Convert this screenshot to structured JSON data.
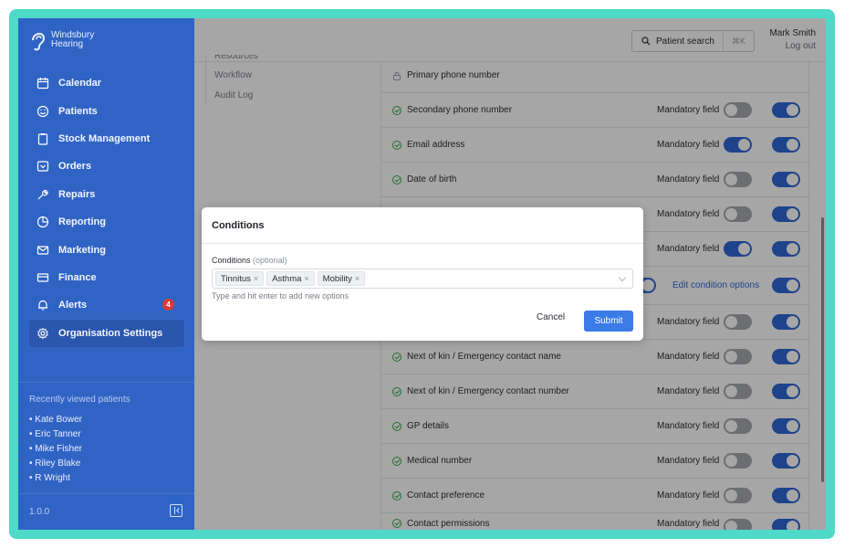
{
  "brand": {
    "line1": "Windsbury",
    "line2": "Hearing"
  },
  "sidebar": {
    "items": [
      {
        "label": "Calendar",
        "icon": "calendar-icon"
      },
      {
        "label": "Patients",
        "icon": "smiley-icon"
      },
      {
        "label": "Stock Management",
        "icon": "clipboard-icon"
      },
      {
        "label": "Orders",
        "icon": "inbox-icon"
      },
      {
        "label": "Repairs",
        "icon": "wrench-icon"
      },
      {
        "label": "Reporting",
        "icon": "pie-chart-icon"
      },
      {
        "label": "Marketing",
        "icon": "mail-icon"
      },
      {
        "label": "Finance",
        "icon": "credit-card-icon"
      },
      {
        "label": "Alerts",
        "icon": "bell-icon",
        "badge": "4"
      },
      {
        "label": "Organisation Settings",
        "icon": "gear-icon",
        "active": true
      }
    ],
    "recent_title": "Recently viewed patients",
    "recent": [
      "• Kate Bower",
      "• Eric Tanner",
      "• Mike Fisher",
      "• Riley Blake",
      "• R Wright"
    ],
    "version": "1.0.0"
  },
  "header": {
    "search_label": "Patient search",
    "search_shortcut": "⌘K",
    "user_name": "Mark Smith",
    "logout": "Log out"
  },
  "subnav": [
    "Resources",
    "Workflow",
    "Audit Log"
  ],
  "fields": {
    "mandatory_label": "Mandatory field",
    "edit_conditions": "Edit condition options",
    "rows": [
      {
        "label": "Primary phone number",
        "locked": true
      },
      {
        "label": "Secondary phone number",
        "mandatory": false,
        "enabled": true
      },
      {
        "label": "Email address",
        "mandatory": true,
        "enabled": true
      },
      {
        "label": "Date of birth",
        "mandatory": false,
        "enabled": true
      },
      {
        "label": "",
        "mandatory": false,
        "enabled": true
      },
      {
        "label": "",
        "mandatory": true,
        "enabled": true
      },
      {
        "label": "",
        "conditions": true,
        "enabled": true
      },
      {
        "label": "",
        "mandatory": false,
        "enabled": true
      },
      {
        "label": "Next of kin / Emergency contact name",
        "mandatory": false,
        "enabled": true
      },
      {
        "label": "Next of kin / Emergency contact number",
        "mandatory": false,
        "enabled": true
      },
      {
        "label": "GP details",
        "mandatory": false,
        "enabled": true
      },
      {
        "label": "Medical number",
        "mandatory": false,
        "enabled": true
      },
      {
        "label": "Contact preference",
        "mandatory": false,
        "enabled": true
      },
      {
        "label": "Contact permissions",
        "mandatory": false,
        "enabled": true
      }
    ]
  },
  "modal": {
    "title": "Conditions",
    "field_label": "Conditions",
    "field_optional": "(optional)",
    "tags": [
      "Tinnitus",
      "Asthma",
      "Mobility"
    ],
    "hint": "Type and hit enter to add new options",
    "cancel": "Cancel",
    "submit": "Submit"
  }
}
